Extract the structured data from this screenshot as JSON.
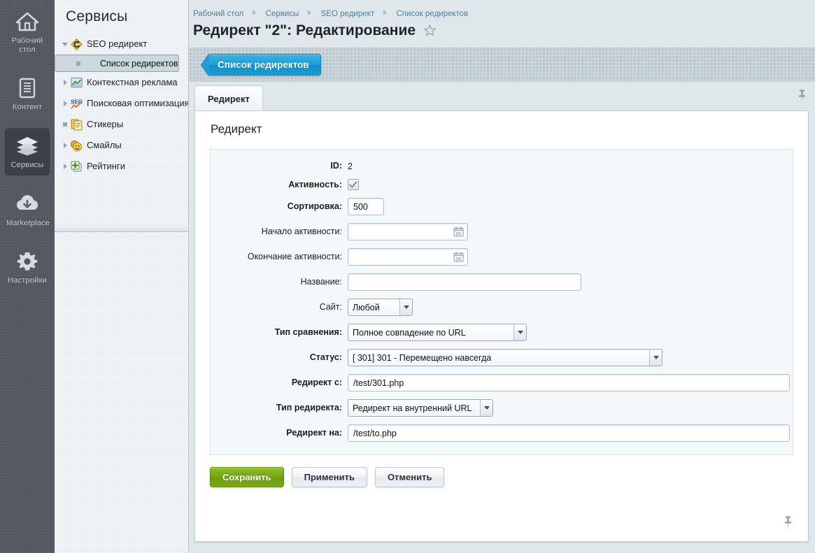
{
  "rail": {
    "items": [
      {
        "label": "Рабочий стол",
        "icon": "home-icon",
        "active": false
      },
      {
        "label": "Контент",
        "icon": "document-icon",
        "active": false
      },
      {
        "label": "Сервисы",
        "icon": "layers-icon",
        "active": true
      },
      {
        "label": "Marketplace",
        "icon": "cloud-download-icon",
        "active": false
      },
      {
        "label": "Настройки",
        "icon": "gear-icon",
        "active": false
      }
    ]
  },
  "menu": {
    "title": "Сервисы",
    "tree": [
      {
        "label": "SEO редирект",
        "icon": "seo-redirect-icon",
        "twisty": "down",
        "level": 1,
        "selected": false
      },
      {
        "label": "Список редиректов",
        "icon": "none",
        "twisty": "dot",
        "level": 2,
        "selected": true
      },
      {
        "label": "Контекстная реклама",
        "icon": "chart-image-icon",
        "twisty": "right",
        "level": 1,
        "selected": false
      },
      {
        "label": "Поисковая оптимизация",
        "icon": "seo-chart-icon",
        "twisty": "right",
        "level": 1,
        "selected": false
      },
      {
        "label": "Стикеры",
        "icon": "sticky-notes-icon",
        "twisty": "dot",
        "level": 1,
        "selected": false
      },
      {
        "label": "Смайлы",
        "icon": "smiley-icon",
        "twisty": "right",
        "level": 1,
        "selected": false
      },
      {
        "label": "Рейтинги",
        "icon": "rating-plus-icon",
        "twisty": "right",
        "level": 1,
        "selected": false
      }
    ]
  },
  "breadcrumb": [
    "Рабочий стол",
    "Сервисы",
    "SEO редирект",
    "Список редиректов"
  ],
  "page": {
    "title": "Редирект \"2\": Редактирование",
    "favorite_icon": "star-outline-icon"
  },
  "toolbar": {
    "back_button": "Список редиректов"
  },
  "tabs": [
    {
      "label": "Редирект",
      "active": true
    }
  ],
  "pin_icon": "pushpin-icon",
  "form": {
    "section_title": "Редирект",
    "fields": {
      "id": {
        "label": "ID:",
        "bold": true,
        "value": "2"
      },
      "active": {
        "label": "Активность:",
        "bold": true,
        "checked": true
      },
      "sort": {
        "label": "Сортировка:",
        "bold": true,
        "value": "500"
      },
      "date_from": {
        "label": "Начало активности:",
        "bold": false,
        "value": "",
        "icon": "calendar-icon"
      },
      "date_to": {
        "label": "Окончание активности:",
        "bold": false,
        "value": "",
        "icon": "calendar-icon"
      },
      "name": {
        "label": "Название:",
        "bold": false,
        "value": ""
      },
      "site": {
        "label": "Сайт:",
        "bold": false,
        "value": "Любой"
      },
      "compare_type": {
        "label": "Тип сравнения:",
        "bold": true,
        "value": "Полное совпадение по URL"
      },
      "status": {
        "label": "Статус:",
        "bold": true,
        "value": "[ 301] 301 - Перемещено навсегда"
      },
      "from_url": {
        "label": "Редирект с:",
        "bold": true,
        "value": "/test/301.php"
      },
      "redir_type": {
        "label": "Тип редиректа:",
        "bold": true,
        "value": "Редирект на внутренний URL"
      },
      "to_url": {
        "label": "Редирект на:",
        "bold": true,
        "value": "/test/to.php"
      }
    }
  },
  "actions": {
    "save": "Сохранить",
    "apply": "Применить",
    "cancel": "Отменить"
  },
  "colors": {
    "accent_blue": "#1b9ed6",
    "save_green": "#7aa714",
    "rail_bg": "#53585f",
    "menu_bg": "#e8eef1",
    "selected_row": "#ccd7de"
  }
}
